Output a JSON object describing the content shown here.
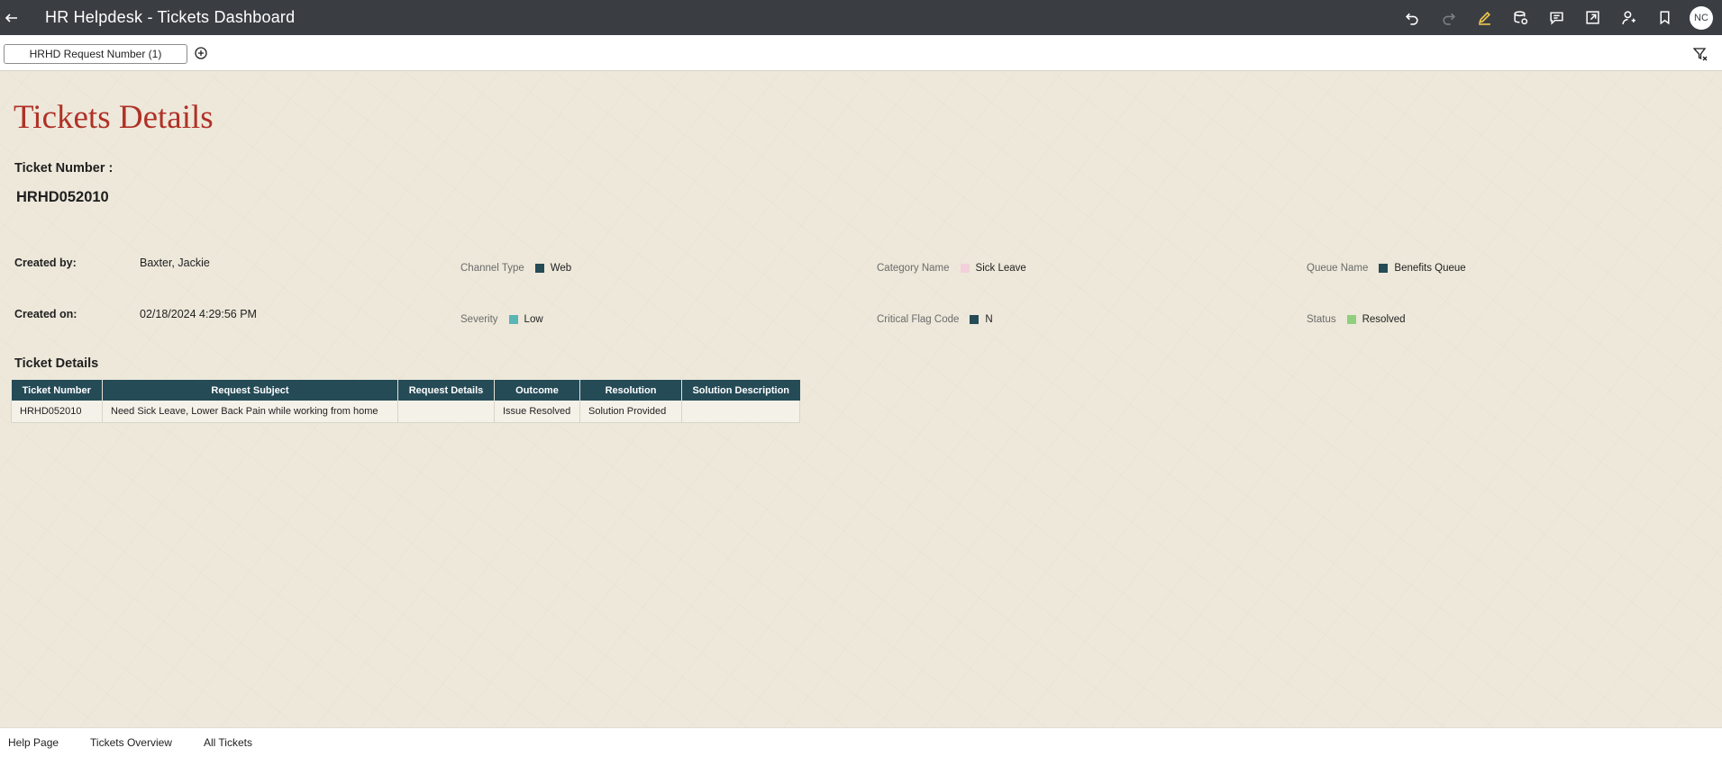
{
  "app": {
    "title": "HR Helpdesk - Tickets Dashboard",
    "avatar_initials": "NC"
  },
  "toolbar_icons": [
    "undo-icon",
    "redo-icon",
    "edit-icon",
    "data-icon",
    "comment-icon",
    "export-icon",
    "user-share-icon",
    "bookmark-icon"
  ],
  "filter_bar": {
    "tab_label": "HRHD Request Number (1)"
  },
  "page": {
    "title": "Tickets Details",
    "ticket_number_label": "Ticket Number :",
    "ticket_number_value": "HRHD052010",
    "created_by_label": "Created by:",
    "created_by_value": "Baxter, Jackie",
    "created_on_label": "Created on:",
    "created_on_value": "02/18/2024 4:29:56 PM"
  },
  "attributes": {
    "channel_type": {
      "label": "Channel Type",
      "value": "Web",
      "color": "#254b57"
    },
    "severity": {
      "label": "Severity",
      "value": "Low",
      "color": "#5bb5b5"
    },
    "category_name": {
      "label": "Category Name",
      "value": "Sick Leave",
      "color": "#f3cfdc"
    },
    "critical_flag_code": {
      "label": "Critical Flag Code",
      "value": "N",
      "color": "#254b57"
    },
    "queue_name": {
      "label": "Queue Name",
      "value": "Benefits Queue",
      "color": "#254b57"
    },
    "status": {
      "label": "Status",
      "value": "Resolved",
      "color": "#8fcf7e"
    }
  },
  "details_table": {
    "title": "Ticket Details",
    "columns": [
      "Ticket Number",
      "Request Subject",
      "Request Details",
      "Outcome",
      "Resolution",
      "Solution Description"
    ],
    "rows": [
      [
        "HRHD052010",
        "Need Sick Leave, Lower Back Pain while working from home",
        "",
        "Issue Resolved",
        "Solution Provided",
        ""
      ]
    ]
  },
  "bottom_tabs": [
    "Help Page",
    "Tickets Overview",
    "All Tickets"
  ]
}
